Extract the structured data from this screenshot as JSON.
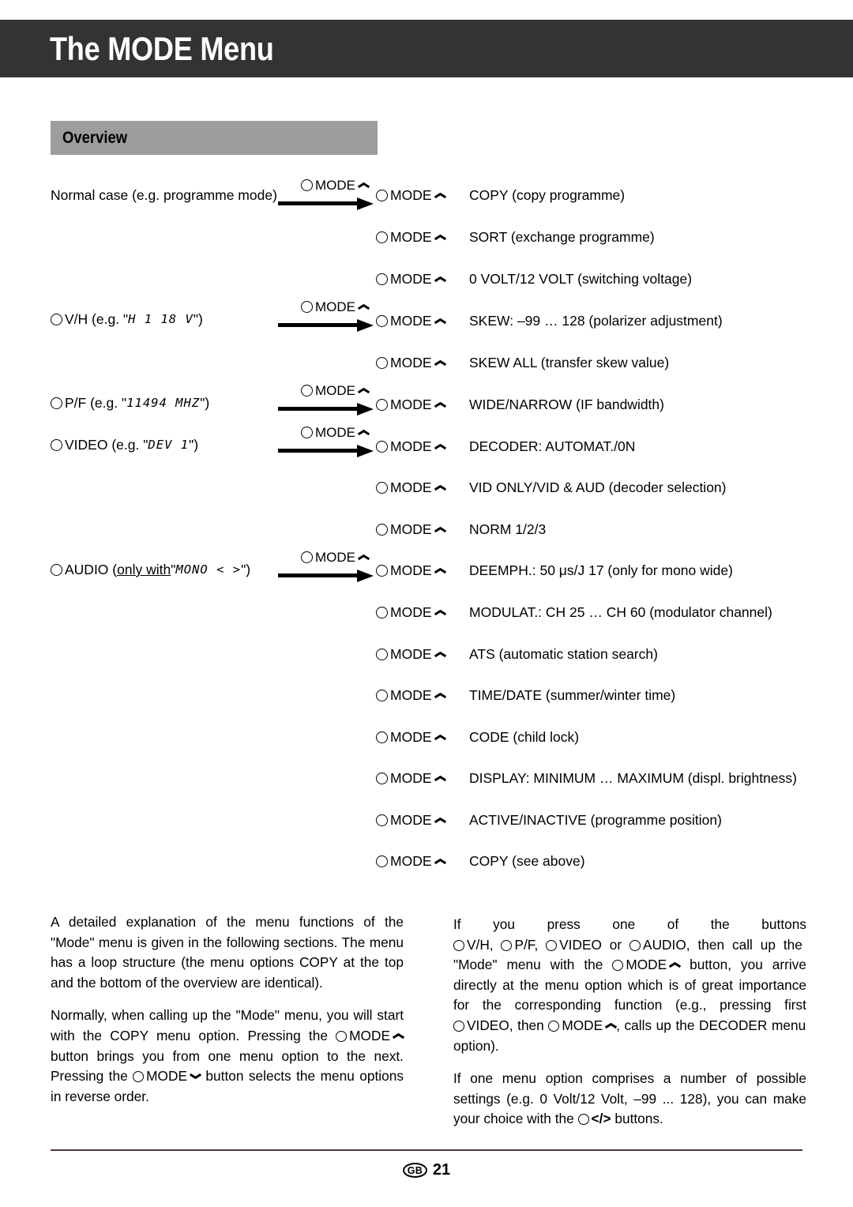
{
  "header": {
    "title": "The MODE Menu"
  },
  "section": {
    "overview_label": "Overview"
  },
  "icons": {
    "ring": "circle-button-icon",
    "chevron_up": "chevron-up-icon",
    "chevron_down": "chevron-down-icon",
    "arrow_right": "arrow-right-icon"
  },
  "colors": {
    "header_bg": "#333334",
    "header_text": "#ffffff",
    "band_bg": "#9d9d9d",
    "body_text": "#000000",
    "rule": "#4a3a3a"
  },
  "diagram": {
    "mode_button_label": "MODE",
    "sources": [
      {
        "id": "normal-case",
        "has_ring": false,
        "text": "Normal case (e.g. programme mode)",
        "lcd": ""
      },
      {
        "id": "vh",
        "has_ring": true,
        "prefix": "V/H (e.g. \"",
        "lcd": "H 1  18  V",
        "suffix": "\")"
      },
      {
        "id": "pf",
        "has_ring": true,
        "prefix": "P/F (e.g. \"",
        "lcd": "11494  MHZ",
        "suffix": "\")"
      },
      {
        "id": "video",
        "has_ring": true,
        "prefix": "VIDEO (e.g. \"",
        "lcd": "DEV   1",
        "suffix": "\")"
      },
      {
        "id": "audio",
        "has_ring": true,
        "prefix_a": "AUDIO (",
        "underlined": "only with",
        "prefix_b": " \"",
        "lcd": "MONO < >",
        "suffix": "\")"
      }
    ],
    "menu_options": [
      "COPY (copy programme)",
      "SORT (exchange programme)",
      "0 VOLT/12 VOLT (switching voltage)",
      "SKEW: –99 … 128 (polarizer adjustment)",
      "SKEW ALL (transfer skew value)",
      "WIDE/NARROW (IF bandwidth)",
      "DECODER: AUTOMAT./0N",
      "VID ONLY/VID & AUD (decoder selection)",
      "NORM 1/2/3",
      "DEEMPH.: 50 μs/J 17 (only for mono wide)",
      "MODULAT.: CH 25 … CH 60 (modulator channel)",
      "ATS (automatic station search)",
      "TIME/DATE (summer/winter time)",
      "CODE (child lock)",
      "DISPLAY: MINIMUM … MAXIMUM (displ. brightness)",
      "ACTIVE/INACTIVE (programme position)",
      "COPY (see above)"
    ]
  },
  "body": {
    "left": {
      "p1": "A detailed explanation of the menu functions of the \"Mode\" menu is given in the following sections. The menu has a loop structure (the menu options COPY at the top and the bottom of the overview are identical).",
      "p2_a": "Normally, when calling up the \"Mode\" menu, you will start with the COPY menu option. Pressing the",
      "p2_btn1": "MODE",
      "p2_b": "button brings you from one menu option to the next. Pressing the",
      "p2_btn2": "MODE",
      "p2_c": "button selects the menu options in reverse order."
    },
    "right": {
      "p1_a": "If you press one of the buttons",
      "p1_btn1": "V/H,",
      "p1_btn2": "P/F,",
      "p1_btn3": "VIDEO or",
      "p1_btn4": "AUDIO,",
      "p1_b": "then call up the \"Mode\" menu with the",
      "p1_btn5": "MODE",
      "p1_c": "button, you arrive directly at the menu option which is of great importance for the corresponding function (e.g., pressing first",
      "p1_btn6": "VIDEO,",
      "p1_d": "then",
      "p1_btn7": "MODE",
      "p1_e": ", calls up the DECODER menu option).",
      "p2_a": "If one menu option comprises a number of possible settings (e.g. 0 Volt/12 Volt, –99 ... 128), you can make your choice with the",
      "p2_btn": "</>",
      "p2_b": "buttons."
    }
  },
  "footer": {
    "region": "GB",
    "page": "21"
  }
}
